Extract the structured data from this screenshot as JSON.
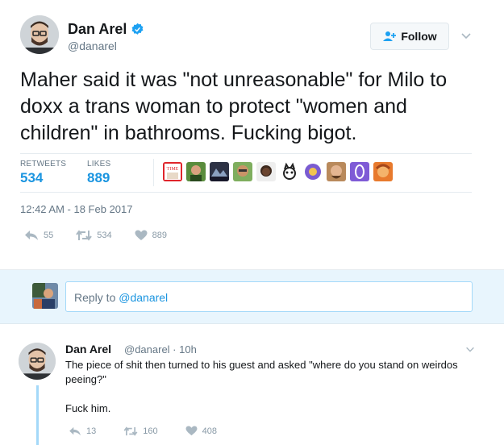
{
  "tweet": {
    "display_name": "Dan Arel",
    "handle": "@danarel",
    "text": "Maher said it was \"not unreasonable\" for Milo to doxx a trans woman to protect \"women and children\" in bathrooms. Fucking bigot.",
    "follow_label": "Follow",
    "retweets_label": "RETWEETS",
    "retweets_count": "534",
    "likes_label": "LIKES",
    "likes_count": "889",
    "timestamp": "12:42 AM - 18 Feb 2017",
    "actions": {
      "reply": "55",
      "retweet": "534",
      "like": "889"
    },
    "verified": true
  },
  "reply_box": {
    "prefix": "Reply to ",
    "mention": "@danarel"
  },
  "reply_tweet": {
    "display_name": "Dan Arel",
    "meta": "@danarel · 10h",
    "text": "The piece of shit then turned to his guest and asked \"where do you stand on weirdos peeing?\"",
    "text2": "Fuck him.",
    "actions": {
      "reply": "13",
      "retweet": "160",
      "like": "408"
    }
  },
  "likers": [
    {
      "name": "time-magazine-avatar",
      "text": "TIME"
    },
    {
      "name": "liker-avatar-2"
    },
    {
      "name": "liker-avatar-3"
    },
    {
      "name": "liker-avatar-4"
    },
    {
      "name": "liker-avatar-5"
    },
    {
      "name": "liker-avatar-6"
    },
    {
      "name": "liker-avatar-7"
    },
    {
      "name": "liker-avatar-8"
    },
    {
      "name": "liker-avatar-9"
    },
    {
      "name": "liker-avatar-10"
    }
  ],
  "colors": {
    "accent": "#1b95e0",
    "muted": "#657786",
    "verified": "#1da1f2",
    "reply_bg": "#e8f5fd"
  }
}
